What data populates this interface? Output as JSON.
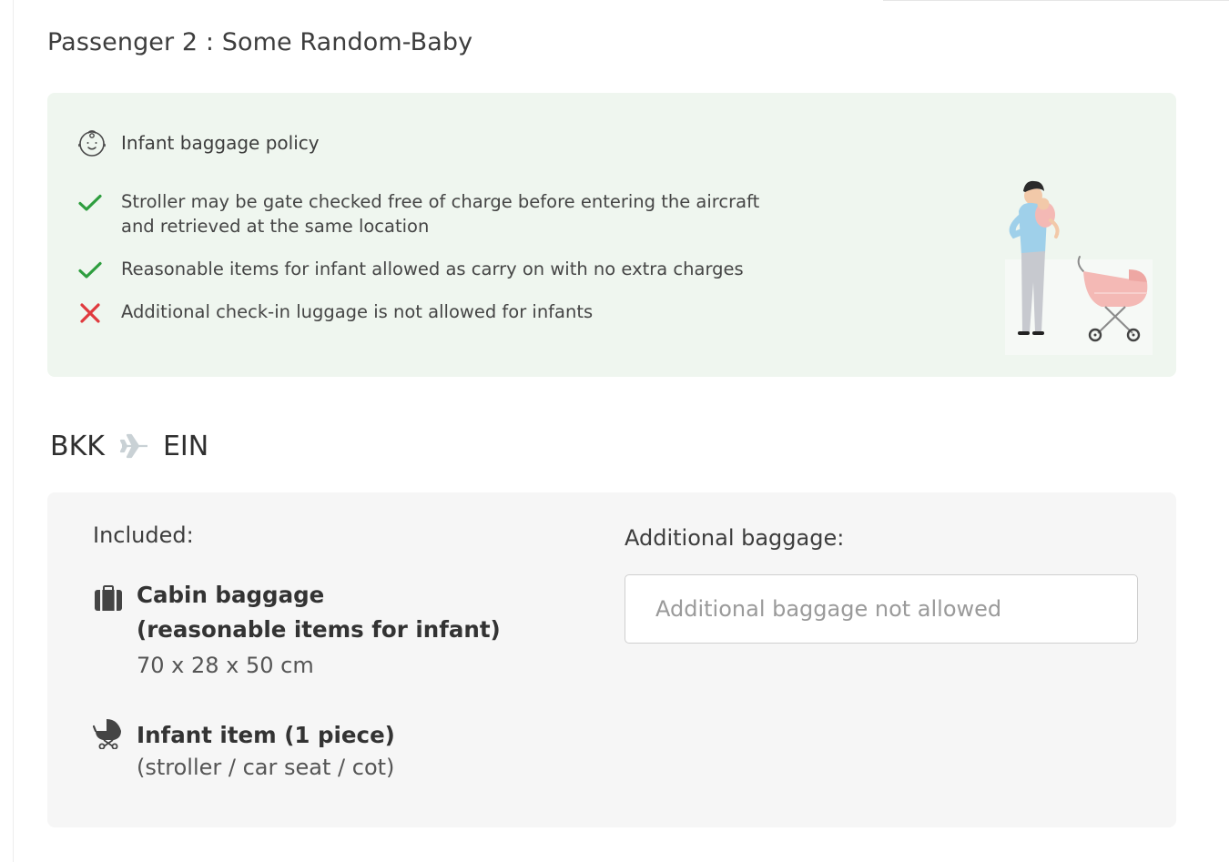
{
  "passenger": {
    "title": "Passenger 2 : Some Random-Baby"
  },
  "policy": {
    "title": "Infant baggage policy",
    "icon": "baby-face-icon",
    "rules": [
      {
        "status": "allowed",
        "icon": "check-icon",
        "lines": [
          "Stroller may be gate checked free of charge before entering the aircraft",
          "and retrieved at the same location"
        ]
      },
      {
        "status": "allowed",
        "icon": "check-icon",
        "lines": [
          "Reasonable items for infant allowed as carry on with no extra charges"
        ]
      },
      {
        "status": "not-allowed",
        "icon": "cross-icon",
        "lines": [
          "Additional check-in luggage is not allowed for infants"
        ]
      }
    ],
    "illustration": "parent-with-baby-and-stroller-illustration"
  },
  "route": {
    "origin": "BKK",
    "destination": "EIN",
    "icon": "plane-icon"
  },
  "baggage": {
    "included_label": "Included:",
    "items": [
      {
        "icon": "suitcase-icon",
        "name_line1": "Cabin baggage",
        "name_line2": "(reasonable items for infant)",
        "dimensions": "70 x 28 x 50 cm"
      },
      {
        "icon": "stroller-icon",
        "name": "Infant item (1 piece)",
        "subtitle": "(stroller / car seat / cot)"
      }
    ],
    "additional": {
      "label": "Additional baggage:",
      "placeholder": "Additional baggage not allowed"
    }
  },
  "colors": {
    "check": "#2e9e3f",
    "cross": "#e03a3e",
    "policy_background": "#eff6ef",
    "baggage_background": "#f6f6f6"
  }
}
